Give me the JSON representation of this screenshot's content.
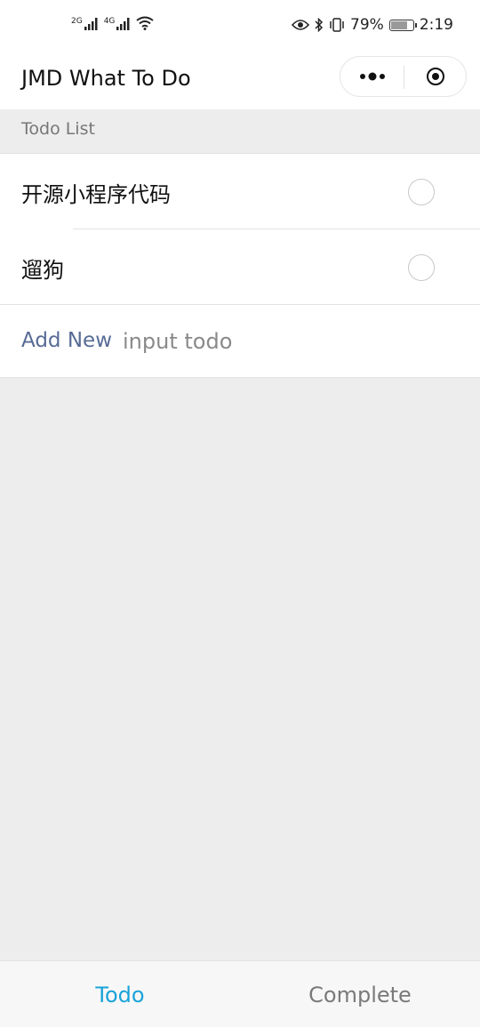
{
  "status_bar": {
    "network_1": "2G",
    "network_2": "4G",
    "battery_percent": "79%",
    "battery_level": 0.79,
    "time": "2:19"
  },
  "nav": {
    "title": "JMD What To Do",
    "more_icon": "more-dots-icon",
    "close_icon": "target-circle-icon"
  },
  "section": {
    "header": "Todo List"
  },
  "todos": [
    {
      "text": "开源小程序代码",
      "done": false
    },
    {
      "text": "遛狗",
      "done": false
    }
  ],
  "add_row": {
    "label": "Add New",
    "placeholder": "input todo",
    "value": ""
  },
  "tabs": [
    {
      "label": "Todo",
      "active": true
    },
    {
      "label": "Complete",
      "active": false
    }
  ],
  "colors": {
    "active_tab": "#1aa3d9",
    "link": "#576b95",
    "background": "#ededed"
  }
}
